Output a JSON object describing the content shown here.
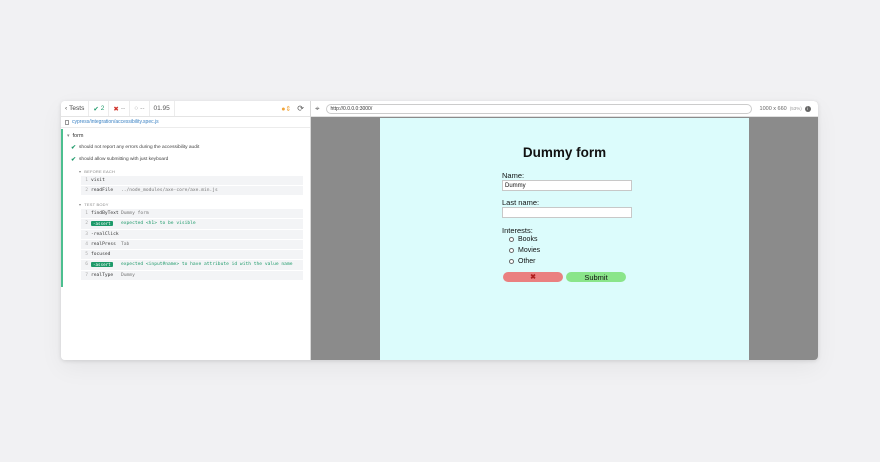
{
  "reporter": {
    "tests_label": "Tests",
    "passed_count": "2",
    "failed_count": "--",
    "pending_count": "--",
    "duration": "01.95",
    "spec_path": "cypress/integration/accessibility.spec.js",
    "suite_title": "form",
    "tests": [
      {
        "title": "should not report any errors during the accessibility audit"
      },
      {
        "title": "should allow submitting with just keyboard"
      }
    ],
    "before_each_label": "BEFORE EACH",
    "before_each_cmds": [
      {
        "num": "1",
        "name": "visit",
        "msg": ""
      },
      {
        "num": "2",
        "name": "readFile",
        "msg": "../node_modules/axe-core/axe.min.js"
      }
    ],
    "test_body_label": "TEST BODY",
    "test_body_cmds": [
      {
        "num": "1",
        "name": "findByText",
        "msg": "Dummy form"
      },
      {
        "num": "2",
        "name": "-assert",
        "msg": "expected <h1> to be visible"
      },
      {
        "num": "3",
        "name": "-realClick",
        "msg": ""
      },
      {
        "num": "4",
        "name": "realPress",
        "msg": "Tab"
      },
      {
        "num": "5",
        "name": "focused",
        "msg": ""
      },
      {
        "num": "6",
        "name": "-assert",
        "msg": "expected <input#name> to have attribute id with the value name"
      },
      {
        "num": "7",
        "name": "realType",
        "msg": "Dummy"
      }
    ]
  },
  "aut": {
    "url": "http://0.0.0.0:3000/",
    "viewport_size": "1000 x 660",
    "viewport_scale": "(53%)",
    "form": {
      "title": "Dummy form",
      "name_label": "Name:",
      "name_value": "Dummy",
      "last_name_label": "Last name:",
      "last_name_value": "",
      "interests_label": "Interests:",
      "options": [
        "Books",
        "Movies",
        "Other"
      ],
      "cancel_glyph": "✖",
      "submit_label": "Submit"
    }
  },
  "colors": {
    "pass": "#1e9a6a",
    "fail": "#d0342c",
    "aut_background": "#dcfcfc",
    "cancel_button": "#ea8080",
    "submit_button": "#8ae58a"
  }
}
